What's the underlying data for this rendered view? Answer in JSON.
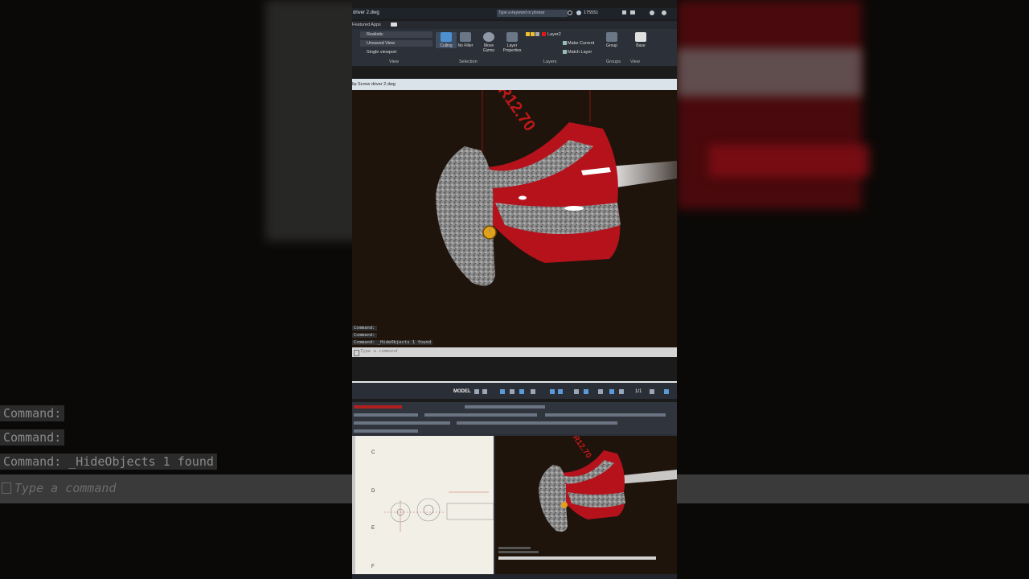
{
  "background": {
    "command_lines": [
      "Command:",
      "Command:",
      "Command: _HideObjects 1 found"
    ],
    "command_placeholder": "Type a command"
  },
  "titlebar": {
    "title": "driver 2.dwg",
    "search_placeholder": "Type a keyword or phrase",
    "user_id": "175551"
  },
  "tabs": {
    "featured": "Featured Apps"
  },
  "ribbon": {
    "visual_style": "Realistic",
    "named_view": "Unsaved View",
    "viewport_config": "Single viewport",
    "view_panel_label": "View",
    "buttons": {
      "culling": "Culling",
      "no_filter": "No Filter",
      "move_gizmo_1": "Move",
      "move_gizmo_2": "Gizmo",
      "layer_properties_1": "Layer",
      "layer_properties_2": "Properties",
      "group": "Group",
      "base": "Base"
    },
    "selection_panel_label": "Selection",
    "layer_name": "Layer2",
    "make_current": "Make Current",
    "match_layer": "Match Layer",
    "layers_panel_label": "Layers",
    "groups_panel_label": "Groups",
    "view2_panel_label": "View"
  },
  "file_tab": {
    "label": "lip Screw driver 2.dwg"
  },
  "viewport": {
    "engraving": "R12.70"
  },
  "command_history": [
    "Command:",
    "Command:",
    "Command: _HideObjects 1 found"
  ],
  "command_placeholder": "Type a command",
  "statusbar": {
    "model": "MODEL",
    "scale": "1/1"
  },
  "mini": {
    "sheet_labels": [
      "C",
      "D",
      "E",
      "F"
    ]
  },
  "colors": {
    "viewport_bg": "#1e140c",
    "handle_red": "#c2141f",
    "grip_red": "#8a8a8a",
    "accent_blue": "#4d90d0"
  }
}
